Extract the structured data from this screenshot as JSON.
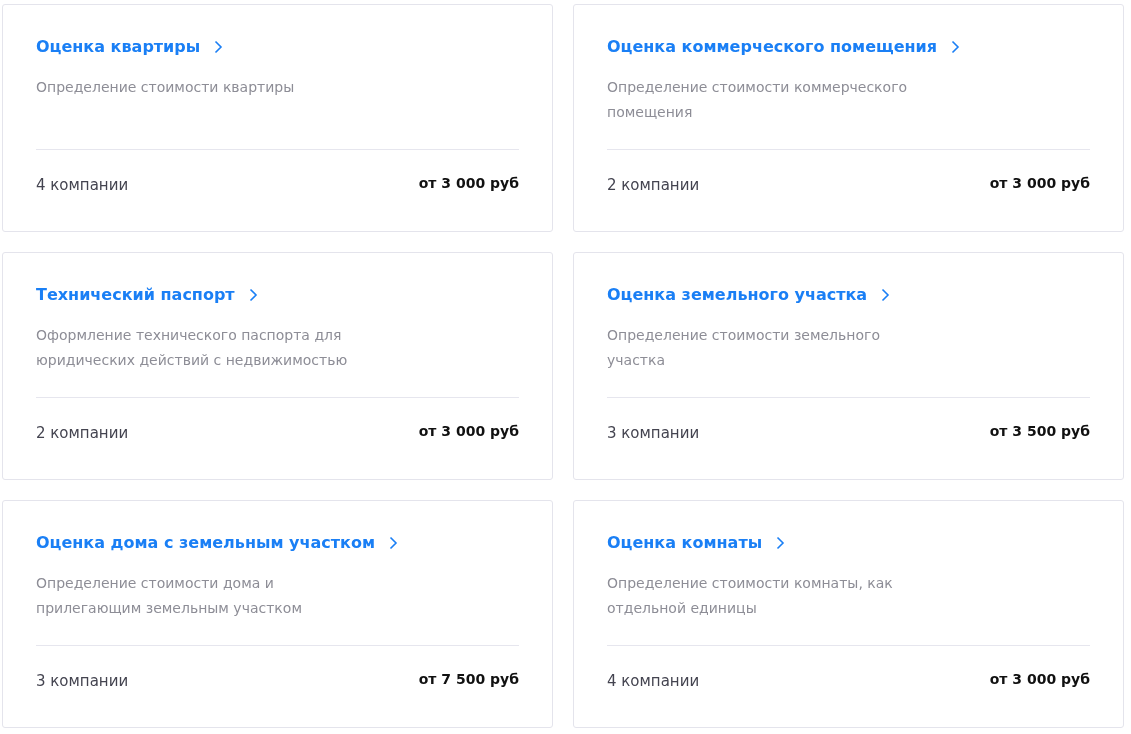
{
  "services": [
    {
      "title": "Оценка квартиры",
      "description": "Определение стоимости квартиры",
      "companies": "4 компании",
      "price": "от 3 000 руб"
    },
    {
      "title": "Оценка коммерческого помещения",
      "description": "Определение стоимости коммерческого помещения",
      "companies": "2 компании",
      "price": "от 3 000 руб"
    },
    {
      "title": "Технический паспорт",
      "description": "Оформление технического паспорта для юридических действий с недвижимостью",
      "companies": "2 компании",
      "price": "от 3 000 руб"
    },
    {
      "title": "Оценка земельного участка",
      "description": "Определение стоимости земельного участка",
      "companies": "3 компании",
      "price": "от 3 500 руб"
    },
    {
      "title": "Оценка дома с земельным участком",
      "description": "Определение стоимости дома и прилегающим земельным участком",
      "companies": "3 компании",
      "price": "от 7 500 руб"
    },
    {
      "title": "Оценка комнаты",
      "description": "Определение стоимости комнаты, как отдельной единицы",
      "companies": "4 компании",
      "price": "от 3 000 руб"
    }
  ]
}
